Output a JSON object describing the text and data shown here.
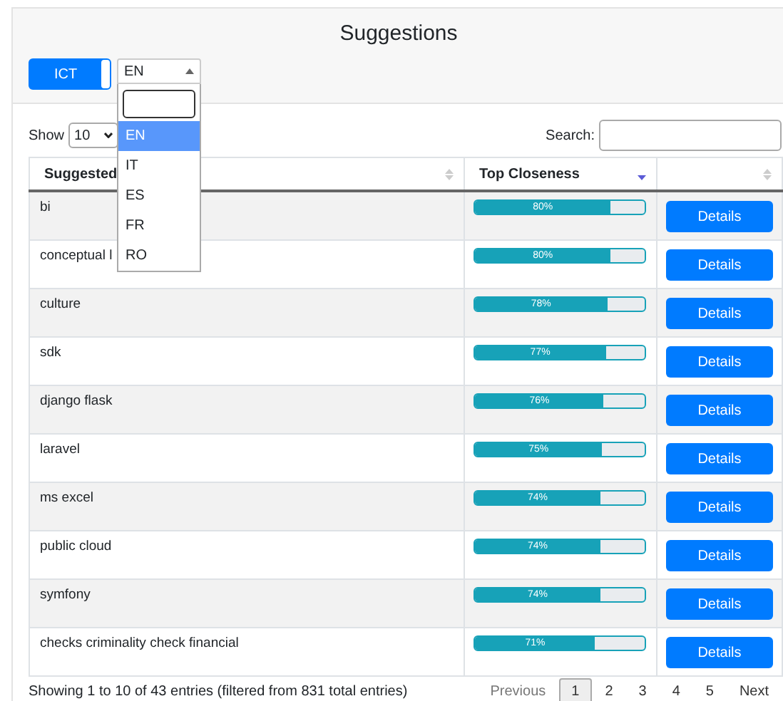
{
  "title": "Suggestions",
  "toggle": {
    "label": "ICT",
    "on": true
  },
  "language": {
    "value": "EN",
    "expanded": true,
    "options": [
      {
        "label": "EN",
        "selected": true
      },
      {
        "label": "IT",
        "selected": false
      },
      {
        "label": "ES",
        "selected": false
      },
      {
        "label": "FR",
        "selected": false
      },
      {
        "label": "RO",
        "selected": false
      }
    ]
  },
  "length": {
    "label": "Show",
    "value": "10"
  },
  "search": {
    "label": "Search:"
  },
  "table": {
    "columns": [
      {
        "label": "Suggested",
        "sorted": false
      },
      {
        "label": "Top Closeness",
        "sorted": true
      },
      {
        "sorted": false
      }
    ],
    "rows": [
      {
        "term": "bi",
        "closeness": "80%",
        "level": 0.8,
        "action": "Details"
      },
      {
        "term": "conceptual l",
        "closeness": "80%",
        "level": 0.8,
        "action": "Details"
      },
      {
        "term": "culture",
        "closeness": "78%",
        "level": 0.78,
        "action": "Details"
      },
      {
        "term": "sdk",
        "closeness": "77%",
        "level": 0.77,
        "action": "Details"
      },
      {
        "term": "django flask",
        "closeness": "76%",
        "level": 0.76,
        "action": "Details"
      },
      {
        "term": "laravel",
        "closeness": "75%",
        "level": 0.75,
        "action": "Details"
      },
      {
        "term": "ms excel",
        "closeness": "74%",
        "level": 0.74,
        "action": "Details"
      },
      {
        "term": "public cloud",
        "closeness": "74%",
        "level": 0.74,
        "action": "Details"
      },
      {
        "term": "symfony",
        "closeness": "74%",
        "level": 0.74,
        "action": "Details"
      },
      {
        "term": "checks criminality check financial",
        "closeness": "71%",
        "level": 0.71,
        "action": "Details"
      }
    ]
  },
  "footer": {
    "info": "Showing 1 to 10 of 43 entries (filtered from 831 total entries)",
    "pages": [
      {
        "label": "Previous",
        "selected": false,
        "disabled": true
      },
      {
        "label": "1",
        "selected": true,
        "disabled": false
      },
      {
        "label": "2",
        "selected": false,
        "disabled": false
      },
      {
        "label": "3",
        "selected": false,
        "disabled": false
      },
      {
        "label": "4",
        "selected": false,
        "disabled": false
      },
      {
        "label": "5",
        "selected": false,
        "disabled": false
      },
      {
        "label": "Next",
        "selected": false,
        "disabled": false
      }
    ]
  }
}
